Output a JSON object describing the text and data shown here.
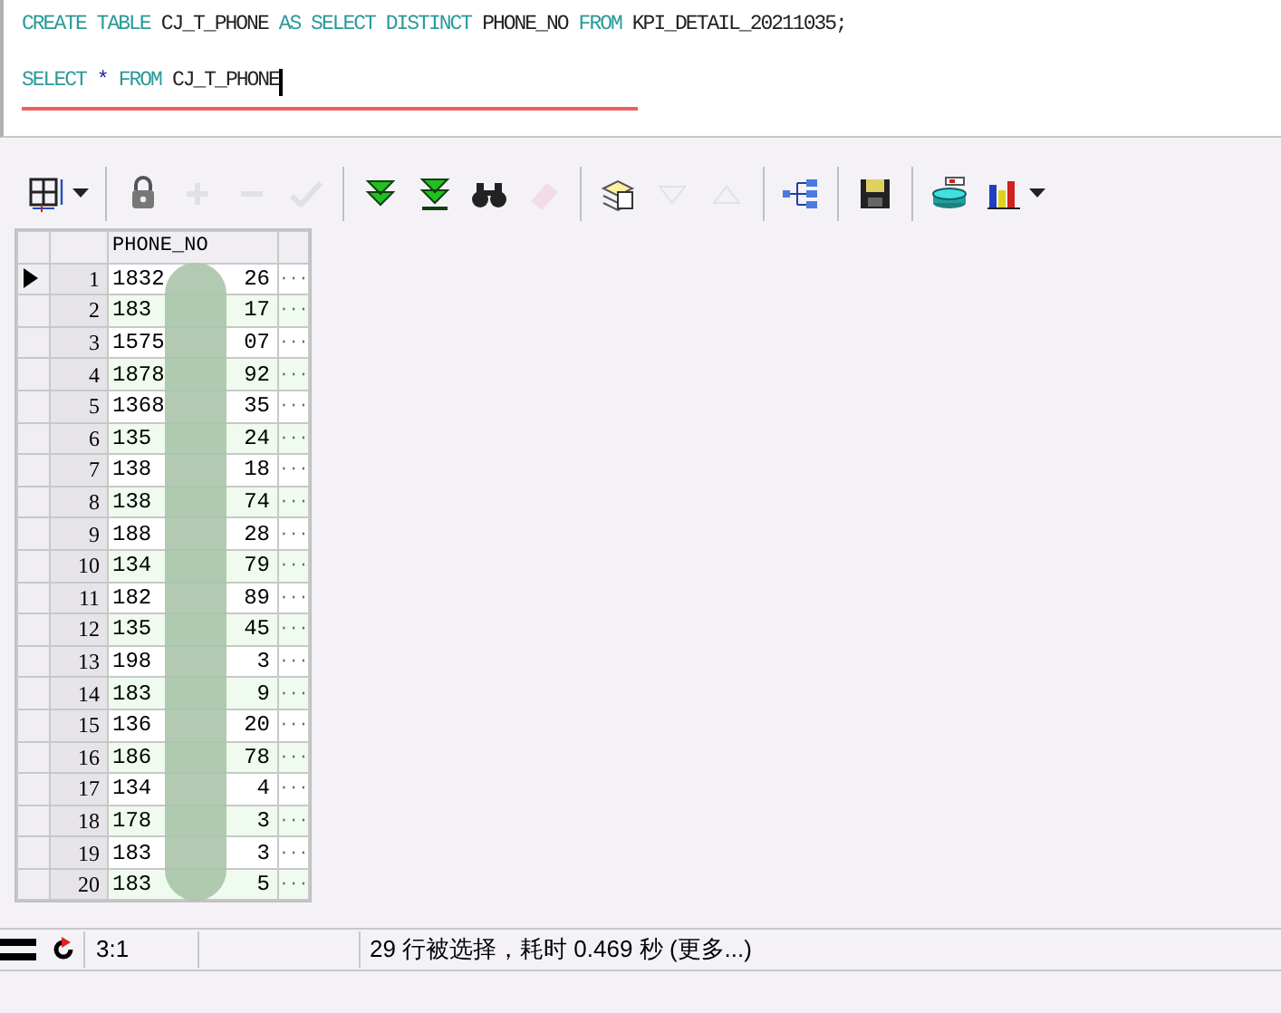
{
  "editor": {
    "lines": [
      [
        {
          "kind": "keyword",
          "text": "CREATE TABLE"
        },
        {
          "kind": "ident",
          "text": "CJ_T_PHONE"
        },
        {
          "kind": "keyword",
          "text": "AS SELECT DISTINCT"
        },
        {
          "kind": "ident",
          "text": "PHONE_NO"
        },
        {
          "kind": "keyword",
          "text": "FROM"
        },
        {
          "kind": "ident",
          "text": "KPI_DETAIL_20211035;"
        }
      ],
      [
        {
          "kind": "keyword",
          "text": "SELECT"
        },
        {
          "kind": "operator",
          "text": "*"
        },
        {
          "kind": "keyword",
          "text": "FROM"
        },
        {
          "kind": "ident",
          "text": "CJ_T_PHONE"
        }
      ]
    ],
    "underlined": [
      false,
      true
    ]
  },
  "toolbar": [
    {
      "kind": "grid",
      "disabled": false,
      "dropdown": true
    },
    {
      "kind": "sep"
    },
    {
      "kind": "lock",
      "disabled": false
    },
    {
      "kind": "plus",
      "disabled": true
    },
    {
      "kind": "minus",
      "disabled": true
    },
    {
      "kind": "check",
      "disabled": true
    },
    {
      "kind": "sep"
    },
    {
      "kind": "fetch-next",
      "disabled": false
    },
    {
      "kind": "fetch-last",
      "disabled": false
    },
    {
      "kind": "find",
      "disabled": false
    },
    {
      "kind": "eraser",
      "disabled": true
    },
    {
      "kind": "sep"
    },
    {
      "kind": "records",
      "disabled": false
    },
    {
      "kind": "down",
      "disabled": true
    },
    {
      "kind": "up",
      "disabled": true
    },
    {
      "kind": "sep"
    },
    {
      "kind": "tree",
      "disabled": false
    },
    {
      "kind": "sep"
    },
    {
      "kind": "save",
      "disabled": false
    },
    {
      "kind": "sep"
    },
    {
      "kind": "database",
      "disabled": false
    },
    {
      "kind": "chart",
      "disabled": false,
      "dropdown": true
    }
  ],
  "grid": {
    "columns": [
      "PHONE_NO"
    ],
    "rows": [
      {
        "number": "1",
        "start": "1832",
        "end": "26",
        "current": true
      },
      {
        "number": "2",
        "start": "183",
        "end": "17",
        "current": false
      },
      {
        "number": "3",
        "start": "1575",
        "end": "07",
        "current": false
      },
      {
        "number": "4",
        "start": "1878",
        "end": "92",
        "current": false
      },
      {
        "number": "5",
        "start": "1368",
        "end": "35",
        "current": false
      },
      {
        "number": "6",
        "start": "135",
        "end": "24",
        "current": false
      },
      {
        "number": "7",
        "start": "138",
        "end": "18",
        "current": false
      },
      {
        "number": "8",
        "start": "138",
        "end": "74",
        "current": false
      },
      {
        "number": "9",
        "start": "188",
        "end": "28",
        "current": false
      },
      {
        "number": "10",
        "start": "134",
        "end": "79",
        "current": false
      },
      {
        "number": "11",
        "start": "182",
        "end": "89",
        "current": false
      },
      {
        "number": "12",
        "start": "135",
        "end": "45",
        "current": false
      },
      {
        "number": "13",
        "start": "198",
        "end": "3",
        "current": false
      },
      {
        "number": "14",
        "start": "183",
        "end": "9",
        "current": false
      },
      {
        "number": "15",
        "start": "136",
        "end": "20",
        "current": false
      },
      {
        "number": "16",
        "start": "186",
        "end": "78",
        "current": false
      },
      {
        "number": "17",
        "start": "134",
        "end": "4",
        "current": false
      },
      {
        "number": "18",
        "start": "178",
        "end": "3",
        "current": false
      },
      {
        "number": "19",
        "start": "183",
        "end": "3",
        "current": false
      },
      {
        "number": "20",
        "start": "183",
        "end": "5",
        "current": false
      }
    ],
    "cell_button": "···"
  },
  "status_bar": {
    "position": "3:1",
    "message": "29 行被选择，耗时 0.469 秒 (更多...)"
  }
}
